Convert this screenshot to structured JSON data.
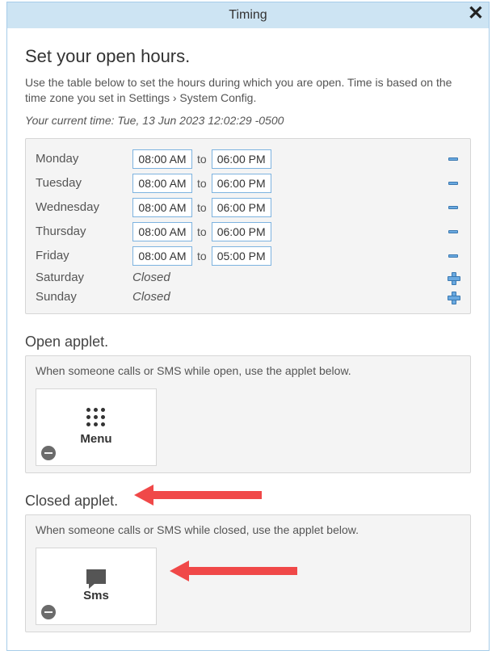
{
  "title": "Timing",
  "heading": "Set your open hours.",
  "description": "Use the table below to set the hours during which you are open. Time is based on the time zone you set in Settings › System Config.",
  "current_time_label": "Your current time: Tue, 13 Jun 2023 12:02:29 -0500",
  "to_label": "to",
  "closed_label": "Closed",
  "days": [
    {
      "name": "Monday",
      "open": "08:00 AM",
      "close": "06:00 PM",
      "closed": false
    },
    {
      "name": "Tuesday",
      "open": "08:00 AM",
      "close": "06:00 PM",
      "closed": false
    },
    {
      "name": "Wednesday",
      "open": "08:00 AM",
      "close": "06:00 PM",
      "closed": false
    },
    {
      "name": "Thursday",
      "open": "08:00 AM",
      "close": "06:00 PM",
      "closed": false
    },
    {
      "name": "Friday",
      "open": "08:00 AM",
      "close": "05:00 PM",
      "closed": false
    },
    {
      "name": "Saturday",
      "open": "",
      "close": "",
      "closed": true
    },
    {
      "name": "Sunday",
      "open": "",
      "close": "",
      "closed": true
    }
  ],
  "open_applet": {
    "heading": "Open applet.",
    "description": "When someone calls or SMS while open, use the applet below.",
    "card_label": "Menu",
    "icon": "grid-icon"
  },
  "closed_applet": {
    "heading": "Closed applet.",
    "description": "When someone calls or SMS while closed, use the applet below.",
    "card_label": "Sms",
    "icon": "sms-icon"
  }
}
